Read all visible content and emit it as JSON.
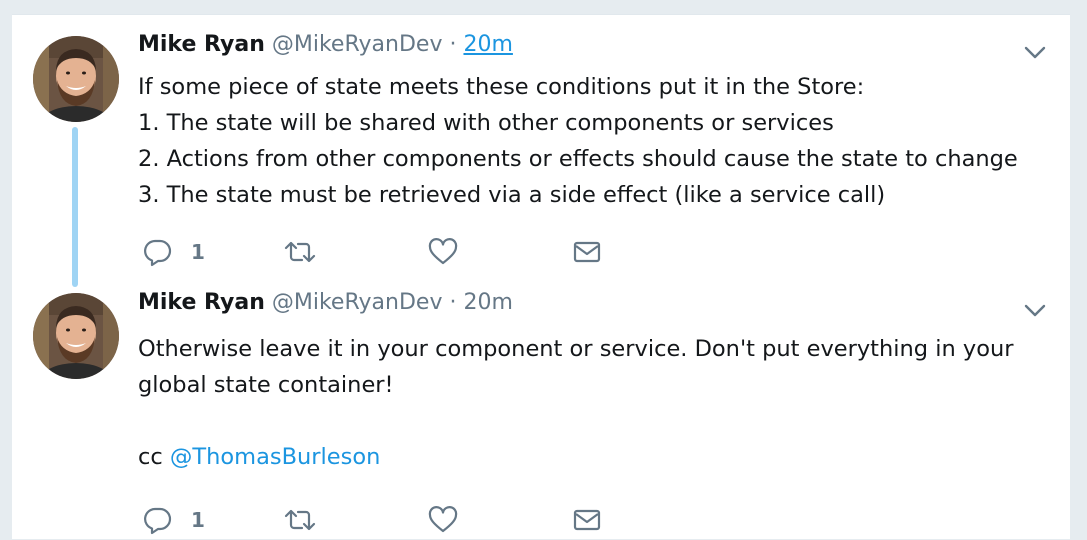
{
  "tweets": [
    {
      "name": "Mike Ryan",
      "handle": "@MikeRyanDev",
      "separator": "·",
      "time": "20m",
      "lines": [
        "If some piece of state meets these conditions put it in the Store:",
        "1. The state will be shared with other components or services",
        "2. Actions from other components or effects should cause the state to change",
        "3. The state must be retrieved via a side effect (like a service call)"
      ],
      "reply_count": "1"
    },
    {
      "name": "Mike Ryan",
      "handle": "@MikeRyanDev",
      "separator": "·",
      "time": "20m",
      "lines": [
        "Otherwise leave it in your component or service. Don't put everything in your",
        "global state container!"
      ],
      "cc_prefix": "cc ",
      "mention": "@ThomasBurleson",
      "reply_count": "1"
    }
  ],
  "icons": {
    "reply": "reply-icon",
    "retweet": "retweet-icon",
    "like": "heart-icon",
    "dm": "envelope-icon",
    "more": "chevron-down-icon"
  },
  "colors": {
    "accent": "#1b95e0",
    "thread_line": "#9fd4f4",
    "muted": "#657786",
    "text": "#14171a"
  }
}
